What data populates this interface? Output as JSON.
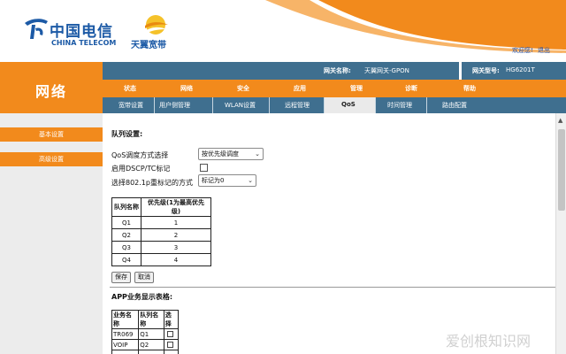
{
  "header": {
    "logo_cn": "中国电信",
    "logo_en": "CHINA TELECOM",
    "brand2": "天翼宽带",
    "login_text": "欢迎您!",
    "logout_text": "退出"
  },
  "brand": {
    "section": "网络"
  },
  "gateway": {
    "name_label": "网关名称:",
    "name_value": "天翼网关-GPON",
    "model_label": "网关型号:",
    "model_value": "HG6201T"
  },
  "nav": {
    "tabs": [
      "状态",
      "网络",
      "安全",
      "应用",
      "管理",
      "诊断",
      "帮助"
    ],
    "subtabs": [
      "宽带设置",
      "用户侧管理",
      "WLAN设置",
      "远程管理",
      "QoS",
      "时间管理",
      "路由配置"
    ],
    "active_sub": "QoS"
  },
  "sidebar": {
    "items": [
      "基本设置",
      "高级设置"
    ]
  },
  "queue": {
    "title": "队列设置:",
    "qos_label": "QoS调度方式选择",
    "qos_value": "按优先级调度",
    "dscp_label": "启用DSCP/TC标记",
    "p8021_label": "选择802.1p重标记的方式",
    "p8021_value": "标记为0",
    "headers": [
      "队列名称",
      "优先级(1为最高优先级)"
    ],
    "rows": [
      [
        "Q1",
        "1"
      ],
      [
        "Q2",
        "2"
      ],
      [
        "Q3",
        "3"
      ],
      [
        "Q4",
        "4"
      ]
    ],
    "save": "保存",
    "cancel": "取消"
  },
  "app_table": {
    "title": "APP业务显示表格:",
    "headers": [
      "业务名称",
      "队列名称",
      "选择"
    ],
    "rows": [
      [
        "TR069",
        "Q1"
      ],
      [
        "VOIP",
        "Q2"
      ]
    ]
  },
  "watermark": "爱创根知识网",
  "colors": {
    "orange": "#f28a1c",
    "steel_blue": "#3f6f8f",
    "telecom_blue": "#1c5aa6"
  }
}
